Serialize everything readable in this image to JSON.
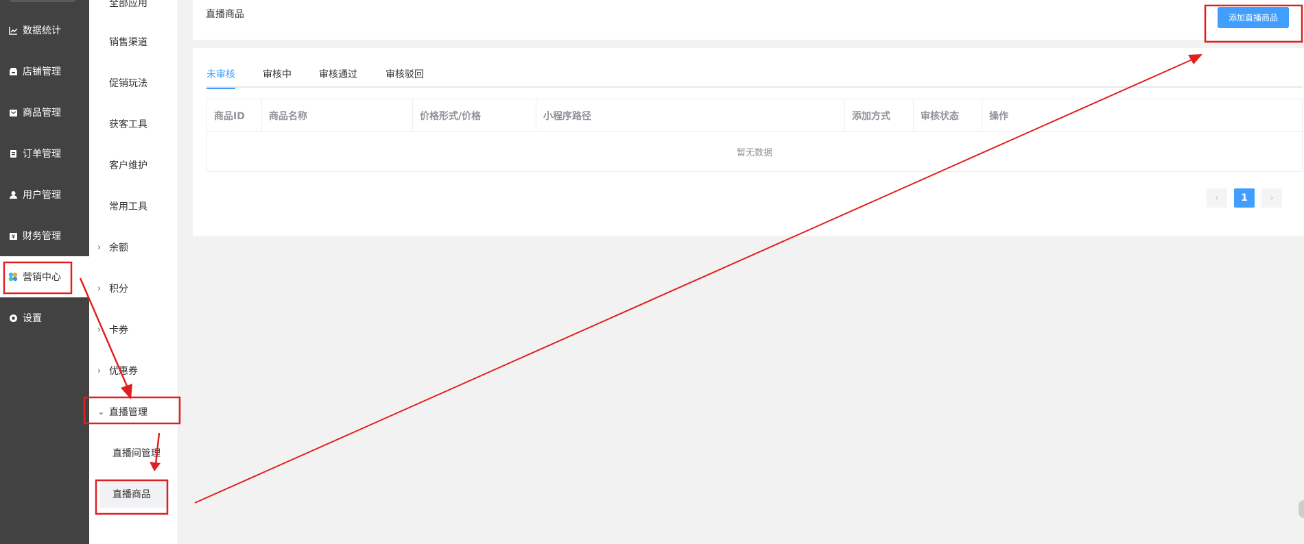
{
  "sidebar": {
    "items": [
      {
        "label": "数据统计",
        "icon": "chart-line-icon"
      },
      {
        "label": "店铺管理",
        "icon": "store-icon"
      },
      {
        "label": "商品管理",
        "icon": "product-icon"
      },
      {
        "label": "订单管理",
        "icon": "order-icon"
      },
      {
        "label": "用户管理",
        "icon": "user-icon"
      },
      {
        "label": "财务管理",
        "icon": "finance-icon"
      },
      {
        "label": "营销中心",
        "icon": "marketing-icon"
      },
      {
        "label": "设置",
        "icon": "gear-icon"
      }
    ],
    "active_index": 6
  },
  "submenu": {
    "top_partial": "全部应用",
    "items": [
      "销售渠道",
      "促销玩法",
      "获客工具",
      "客户维护",
      "常用工具"
    ],
    "groups": [
      "余额",
      "积分",
      "卡券",
      "优惠券",
      "直播管理"
    ],
    "live_children": [
      "直播间管理",
      "直播商品"
    ]
  },
  "header": {
    "title": "直播商品",
    "add_button": "添加直播商品"
  },
  "tabs": [
    "未审核",
    "审核中",
    "审核通过",
    "审核驳回"
  ],
  "active_tab": 0,
  "table": {
    "columns": [
      "商品ID",
      "商品名称",
      "价格形式/价格",
      "小程序路径",
      "添加方式",
      "审核状态",
      "操作"
    ],
    "empty_text": "暂无数据"
  },
  "pagination": {
    "prev": "‹",
    "current": "1",
    "next": "›"
  },
  "colors": {
    "sidebar_bg": "#424242",
    "primary": "#409eff",
    "annotation_red": "#e02020"
  }
}
